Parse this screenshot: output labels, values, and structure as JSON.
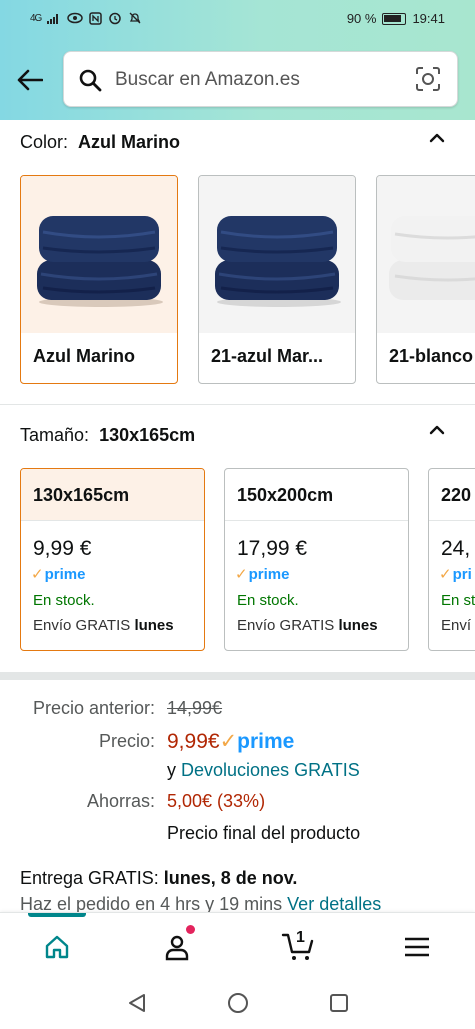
{
  "status_bar": {
    "network": "4G",
    "battery": "90 %",
    "time": "19:41"
  },
  "search": {
    "placeholder": "Buscar en Amazon.es"
  },
  "color": {
    "label": "Color:",
    "selected": "Azul Marino",
    "options": [
      {
        "label": "Azul Marino"
      },
      {
        "label": "21-azul Mar..."
      },
      {
        "label": "21-blanco"
      }
    ]
  },
  "size": {
    "label": "Tamaño:",
    "selected": "130x165cm",
    "options": [
      {
        "size": "130x165cm",
        "price": "9,99 €",
        "prime": "prime",
        "stock": "En stock.",
        "ship_prefix": "Envío GRATIS",
        "ship_day": "lunes"
      },
      {
        "size": "150x200cm",
        "price": "17,99 €",
        "prime": "prime",
        "stock": "En stock.",
        "ship_prefix": "Envío GRATIS",
        "ship_day": "lunes"
      },
      {
        "size": "220",
        "price": "24,",
        "prime": "pri",
        "stock": "En st",
        "ship_prefix": "Enví",
        "ship_day": ""
      }
    ]
  },
  "pricing": {
    "previous_label": "Precio anterior:",
    "previous_value": "14,99€",
    "price_label": "Precio:",
    "price_value": "9,99€",
    "prime": "prime",
    "returns_prefix": "y",
    "returns_link": "Devoluciones GRATIS",
    "savings_label": "Ahorras:",
    "savings_value": "5,00€ (33%)",
    "final_note": "Precio final del producto"
  },
  "delivery": {
    "label": "Entrega GRATIS:",
    "date": "lunes, 8 de nov.",
    "order_within": "Haz el pedido en 4 hrs y 19 mins",
    "details_link": "Ver detalles"
  },
  "bottom_nav": {
    "cart_count": "1"
  },
  "colors": {
    "accent_selected": "#e47911",
    "link": "#007185",
    "price_red": "#b12704",
    "stock_green": "#007600",
    "prime_blue": "#1a98ff",
    "nav_active": "#00868b"
  }
}
